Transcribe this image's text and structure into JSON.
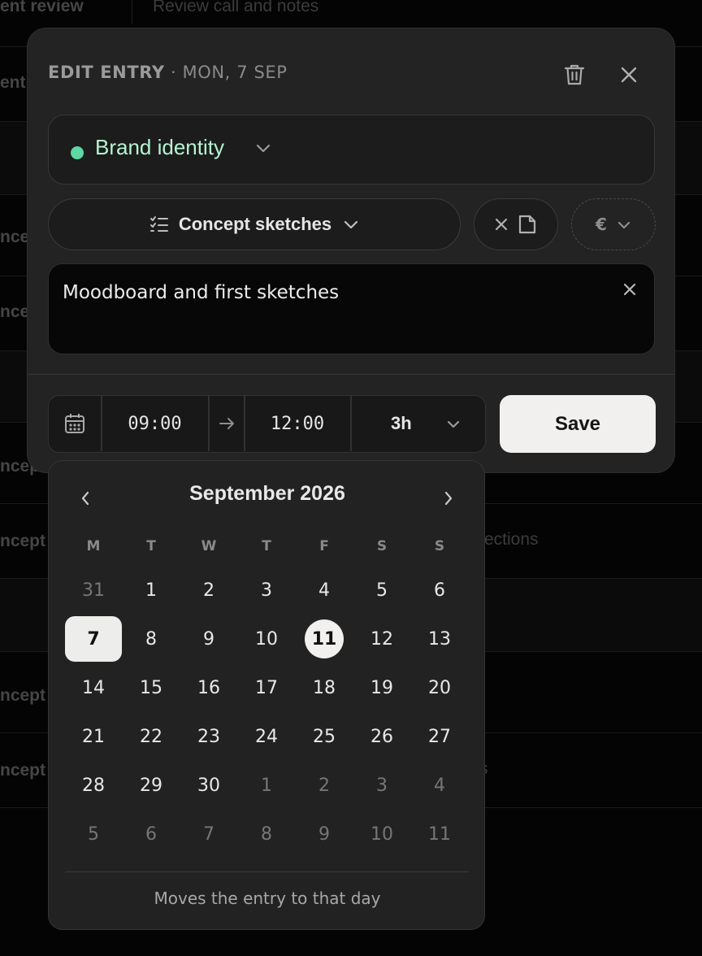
{
  "background": {
    "header": {
      "col1": "ent review",
      "col2": "Review call and notes"
    },
    "rows": [
      {
        "label": "ent",
        "note": ""
      },
      {
        "label": "nce",
        "note": ""
      },
      {
        "label": "nce",
        "note": ""
      },
      {
        "label": "ncep",
        "note": ""
      },
      {
        "label": "ncept",
        "note": "ections"
      },
      {
        "label": "ncept",
        "note": ""
      },
      {
        "label": "ncept",
        "note": "s"
      }
    ]
  },
  "dialog": {
    "title": "EDIT ENTRY",
    "date": " · MON, 7 SEP",
    "project": {
      "name": "Brand identity",
      "color": "#5bd8a3"
    },
    "task": {
      "name": "Concept sketches"
    },
    "billing": {
      "currency": "€"
    },
    "description": "Moodboard and first sketches",
    "time": {
      "start": "09:00",
      "end": "12:00",
      "duration": "3h"
    },
    "save_label": "Save"
  },
  "calendar": {
    "month": "September 2026",
    "weekdays": [
      "M",
      "T",
      "W",
      "T",
      "F",
      "S",
      "S"
    ],
    "weeks": [
      [
        {
          "d": "31",
          "muted": true
        },
        {
          "d": "1"
        },
        {
          "d": "2"
        },
        {
          "d": "3"
        },
        {
          "d": "4"
        },
        {
          "d": "5"
        },
        {
          "d": "6"
        }
      ],
      [
        {
          "d": "7",
          "selected": true
        },
        {
          "d": "8"
        },
        {
          "d": "9"
        },
        {
          "d": "10"
        },
        {
          "d": "11",
          "today": true
        },
        {
          "d": "12"
        },
        {
          "d": "13"
        }
      ],
      [
        {
          "d": "14"
        },
        {
          "d": "15"
        },
        {
          "d": "16"
        },
        {
          "d": "17"
        },
        {
          "d": "18"
        },
        {
          "d": "19"
        },
        {
          "d": "20"
        }
      ],
      [
        {
          "d": "21"
        },
        {
          "d": "22"
        },
        {
          "d": "23"
        },
        {
          "d": "24"
        },
        {
          "d": "25"
        },
        {
          "d": "26"
        },
        {
          "d": "27"
        }
      ],
      [
        {
          "d": "28"
        },
        {
          "d": "29"
        },
        {
          "d": "30"
        },
        {
          "d": "1",
          "muted": true
        },
        {
          "d": "2",
          "muted": true
        },
        {
          "d": "3",
          "muted": true
        },
        {
          "d": "4",
          "muted": true
        }
      ],
      [
        {
          "d": "5",
          "muted": true
        },
        {
          "d": "6",
          "muted": true
        },
        {
          "d": "7",
          "muted": true
        },
        {
          "d": "8",
          "muted": true
        },
        {
          "d": "9",
          "muted": true
        },
        {
          "d": "10",
          "muted": true
        },
        {
          "d": "11",
          "muted": true
        }
      ]
    ],
    "hint": "Moves the entry to that day"
  }
}
